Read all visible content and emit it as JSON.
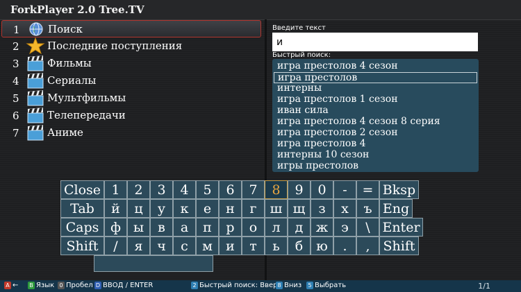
{
  "app": {
    "title": "ForkPlayer 2.0 Tree.TV"
  },
  "menu": [
    {
      "num": "1",
      "label": "Поиск",
      "icon": "globe-icon"
    },
    {
      "num": "2",
      "label": "Последние поступления",
      "icon": "star-icon"
    },
    {
      "num": "3",
      "label": "Фильмы",
      "icon": "film-clapper-icon"
    },
    {
      "num": "4",
      "label": "Сериалы",
      "icon": "film-clapper-icon"
    },
    {
      "num": "5",
      "label": "Мультфильмы",
      "icon": "film-clapper-icon"
    },
    {
      "num": "6",
      "label": "Телепередачи",
      "icon": "film-clapper-icon"
    },
    {
      "num": "7",
      "label": "Аниме",
      "icon": "film-clapper-icon"
    }
  ],
  "search": {
    "label": "Введите текст",
    "value": "и",
    "quick_label": "Быстрый поиск:",
    "suggestions": [
      "игра престолов 4 сезон",
      "игра престолов",
      "интерны",
      "игра престолов 1 сезон",
      "иван сила",
      "игра престолов 4 сезон 8 серия",
      "игра престолов 2 сезон",
      "игра престолов 4",
      "интерны 10 сезон",
      "игры престолов"
    ],
    "selected_suggestion": 1
  },
  "keyboard": {
    "rows": [
      [
        "Close",
        "1",
        "2",
        "3",
        "4",
        "5",
        "6",
        "7",
        "8",
        "9",
        "0",
        "-",
        "=",
        "Bksp"
      ],
      [
        "Tab",
        "й",
        "ц",
        "у",
        "к",
        "е",
        "н",
        "г",
        "ш",
        "щ",
        "з",
        "х",
        "ъ",
        "Eng"
      ],
      [
        "Caps",
        "ф",
        "ы",
        "в",
        "а",
        "п",
        "р",
        "о",
        "л",
        "д",
        "ж",
        "э",
        "\\",
        "Enter"
      ],
      [
        "Shift",
        "/",
        "я",
        "ч",
        "с",
        "м",
        "и",
        "т",
        "ь",
        "б",
        "ю",
        ".",
        ",",
        "Shift"
      ]
    ],
    "active_key": "8"
  },
  "footer": {
    "items": [
      {
        "badge": "A",
        "color": "#c0392b",
        "text": "←"
      },
      {
        "badge": "B",
        "color": "#2e9a3e",
        "text": "Язык"
      },
      {
        "badge": "0",
        "color": "#555555",
        "text": "Пробел"
      },
      {
        "badge": "D",
        "color": "#2f5fb3",
        "text": "ВВОД / ENTER"
      },
      {
        "badge": "2",
        "color": "#2f7fb3",
        "text": "Быстрый поиск: Вверх"
      },
      {
        "badge": "8",
        "color": "#2f7fb3",
        "text": "Вниз"
      },
      {
        "badge": "5",
        "color": "#2f7fb3",
        "text": "Выбрать"
      }
    ],
    "pager": "1/1"
  }
}
